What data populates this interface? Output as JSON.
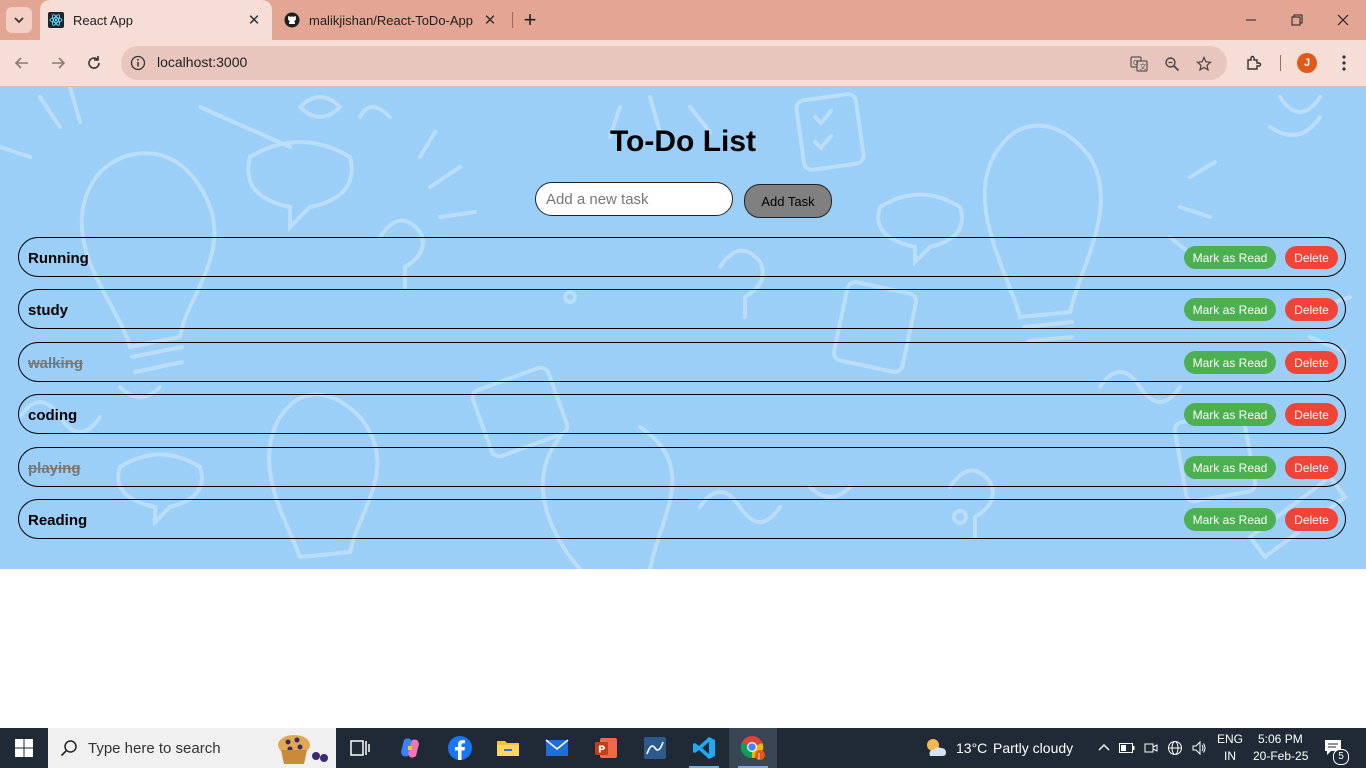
{
  "browser": {
    "tabs": [
      {
        "title": "React App",
        "active": true
      },
      {
        "title": "malikjishan/React-ToDo-App",
        "active": false
      }
    ],
    "url": "localhost:3000",
    "profile_initial": "J"
  },
  "app": {
    "heading": "To-Do List",
    "input_placeholder": "Add a new task",
    "add_button": "Add Task",
    "mark_label": "Mark as Read",
    "delete_label": "Delete",
    "tasks": [
      {
        "name": "Running",
        "completed": false
      },
      {
        "name": "study",
        "completed": false
      },
      {
        "name": "walking",
        "completed": true
      },
      {
        "name": "coding",
        "completed": false
      },
      {
        "name": "playing",
        "completed": true
      },
      {
        "name": "Reading",
        "completed": false
      }
    ]
  },
  "taskbar": {
    "search_placeholder": "Type here to search",
    "weather_temp": "13°C",
    "weather_desc": "Partly cloudy",
    "language": "ENG",
    "region": "IN",
    "time": "5:06 PM",
    "date": "20-Feb-25",
    "notification_count": "5"
  }
}
